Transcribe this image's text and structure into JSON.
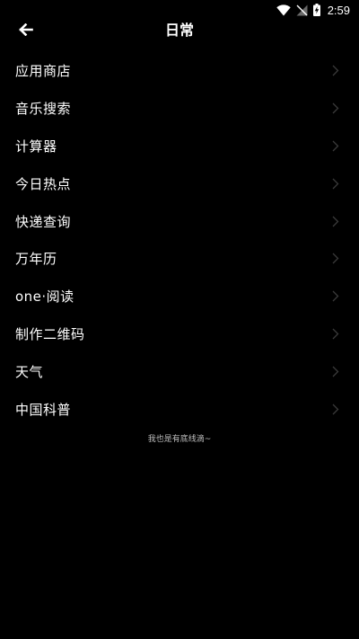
{
  "status_bar": {
    "time": "2:59",
    "icons": [
      "wifi-icon",
      "signal-off-icon",
      "battery-charging-icon"
    ]
  },
  "header": {
    "title": "日常",
    "back_icon": "arrow-left-icon"
  },
  "menu": {
    "items": [
      {
        "label": "应用商店"
      },
      {
        "label": "音乐搜索"
      },
      {
        "label": "计算器"
      },
      {
        "label": "今日热点"
      },
      {
        "label": "快递查询"
      },
      {
        "label": "万年历"
      },
      {
        "label": "one·阅读"
      },
      {
        "label": "制作二维码"
      },
      {
        "label": "天气"
      },
      {
        "label": "中国科普"
      }
    ],
    "chevron_icon": "chevron-right-icon"
  },
  "footer": {
    "note": "我也是有底线滴~"
  },
  "colors": {
    "background": "#000000",
    "text": "#ffffff",
    "chevron": "#3a3a3a",
    "footer_text": "#bdbdbd"
  }
}
